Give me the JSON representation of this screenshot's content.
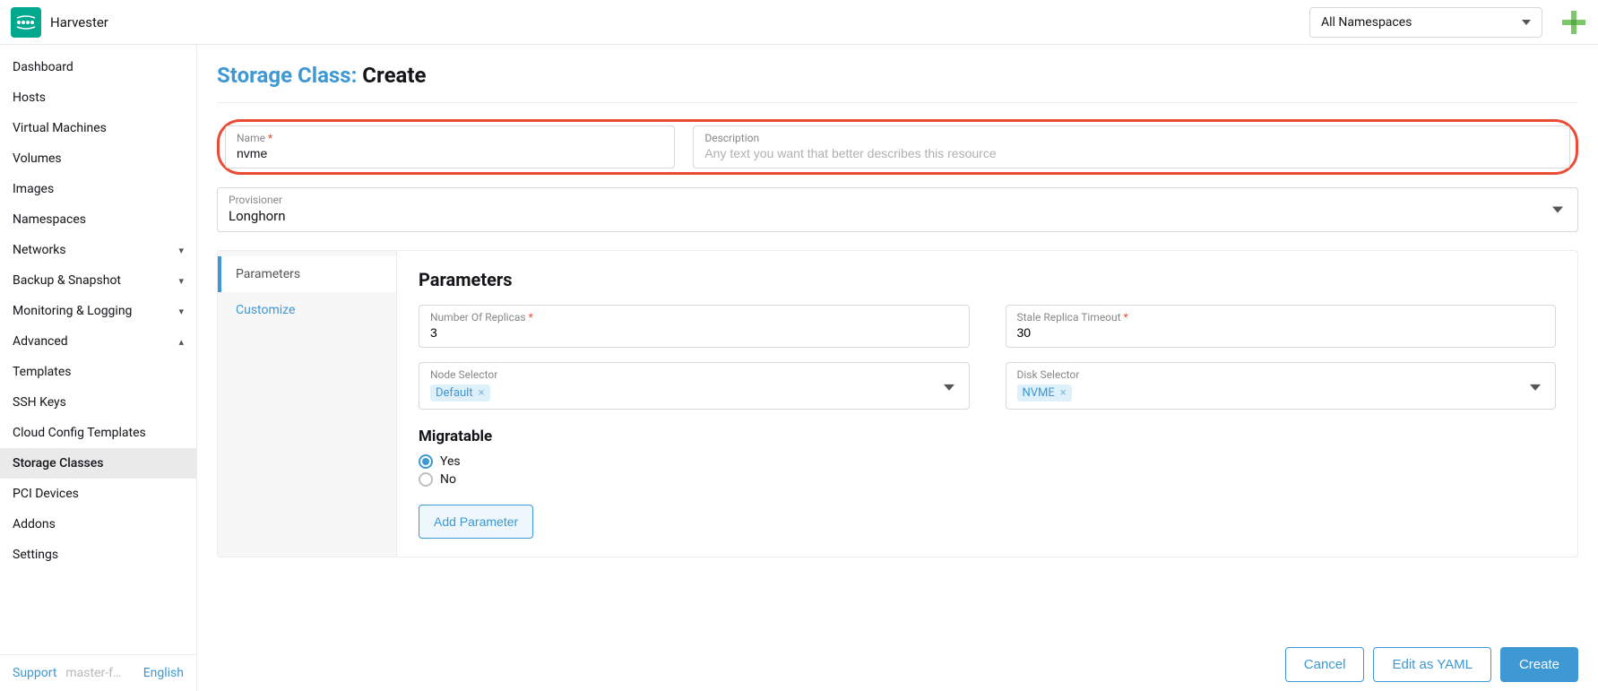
{
  "header": {
    "brand": "Harvester",
    "ns_selected": "All Namespaces"
  },
  "sidebar": {
    "items": [
      {
        "label": "Dashboard",
        "type": "item"
      },
      {
        "label": "Hosts",
        "type": "item"
      },
      {
        "label": "Virtual Machines",
        "type": "item"
      },
      {
        "label": "Volumes",
        "type": "item"
      },
      {
        "label": "Images",
        "type": "item"
      },
      {
        "label": "Namespaces",
        "type": "item"
      },
      {
        "label": "Networks",
        "type": "group",
        "expanded": false
      },
      {
        "label": "Backup & Snapshot",
        "type": "group",
        "expanded": false
      },
      {
        "label": "Monitoring & Logging",
        "type": "group",
        "expanded": false
      },
      {
        "label": "Advanced",
        "type": "group",
        "expanded": true
      },
      {
        "label": "Templates",
        "type": "sub"
      },
      {
        "label": "SSH Keys",
        "type": "sub"
      },
      {
        "label": "Cloud Config Templates",
        "type": "sub"
      },
      {
        "label": "Storage Classes",
        "type": "sub",
        "active": true
      },
      {
        "label": "PCI Devices",
        "type": "sub"
      },
      {
        "label": "Addons",
        "type": "sub"
      },
      {
        "label": "Settings",
        "type": "sub"
      }
    ],
    "footer": {
      "support": "Support",
      "version": "master-f…",
      "language": "English"
    }
  },
  "page": {
    "crumb": "Storage Class:",
    "leaf": "Create"
  },
  "form": {
    "name_label": "Name",
    "name_value": "nvme",
    "desc_label": "Description",
    "desc_placeholder": "Any text you want that better describes this resource",
    "provisioner_label": "Provisioner",
    "provisioner_value": "Longhorn"
  },
  "tabs": {
    "t0": "Parameters",
    "t1": "Customize"
  },
  "parameters": {
    "title": "Parameters",
    "replicas_label": "Number Of Replicas",
    "replicas_value": "3",
    "stale_label": "Stale Replica Timeout",
    "stale_value": "30",
    "node_selector_label": "Node Selector",
    "node_selector_tag": "Default",
    "disk_selector_label": "Disk Selector",
    "disk_selector_tag": "NVME",
    "migratable_label": "Migratable",
    "opt_yes": "Yes",
    "opt_no": "No",
    "add_param": "Add Parameter"
  },
  "actions": {
    "cancel": "Cancel",
    "edit_yaml": "Edit as YAML",
    "create": "Create"
  }
}
